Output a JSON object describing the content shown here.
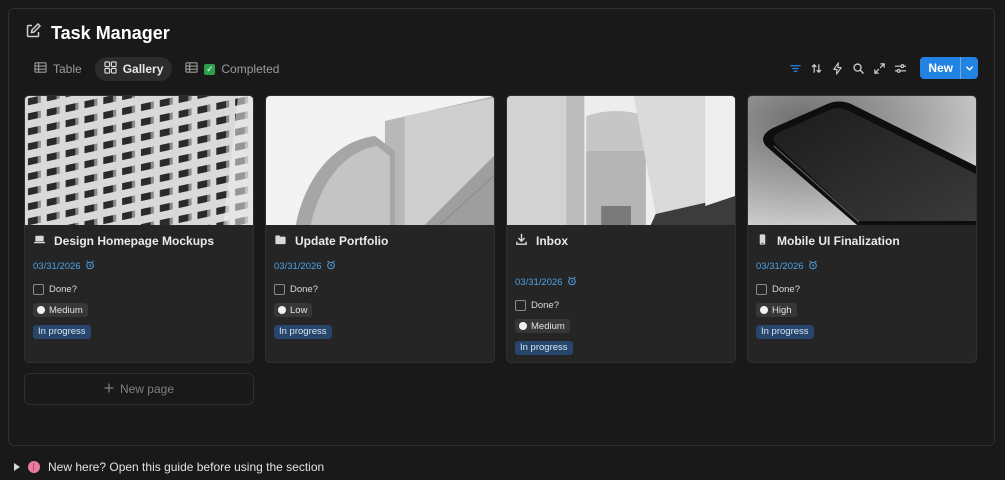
{
  "header": {
    "title": "Task Manager",
    "icon": "edit-square-icon"
  },
  "tabs": [
    {
      "label": "Table",
      "icon": "table-icon",
      "active": false
    },
    {
      "label": "Gallery",
      "icon": "gallery-grid-icon",
      "active": true
    },
    {
      "label": "Completed",
      "icon": "table-icon",
      "emoji": "check-mark-emoji",
      "active": false
    }
  ],
  "toolbar": {
    "icons": [
      "filter-icon",
      "sort-icon",
      "automation-bolt-icon",
      "search-icon",
      "expand-icon",
      "settings-sliders-icon"
    ],
    "new_label": "New",
    "accent": "#2383e2"
  },
  "cards": [
    {
      "title": "Design Homepage Mockups",
      "icon": "laptop-icon",
      "date": "03/31/2026",
      "done_label": "Done?",
      "priority": "Medium",
      "status": "In progress"
    },
    {
      "title": "Update Portfolio",
      "icon": "folder-icon",
      "date": "03/31/2026",
      "done_label": "Done?",
      "priority": "Low",
      "status": "In progress"
    },
    {
      "title": "Inbox",
      "icon": "download-tray-icon",
      "date": "03/31/2026",
      "done_label": "Done?",
      "priority": "Medium",
      "status": "In progress"
    },
    {
      "title": "Mobile UI Finalization",
      "icon": "mobile-phone-icon",
      "date": "03/31/2026",
      "done_label": "Done?",
      "priority": "High",
      "status": "In progress"
    }
  ],
  "new_page": {
    "label": "New page"
  },
  "guide": {
    "text": "New here? Open this guide before using the section"
  },
  "colors": {
    "background": "#191919",
    "card": "#252525",
    "date": "#4ea3e6",
    "status_bg": "#28456c"
  }
}
